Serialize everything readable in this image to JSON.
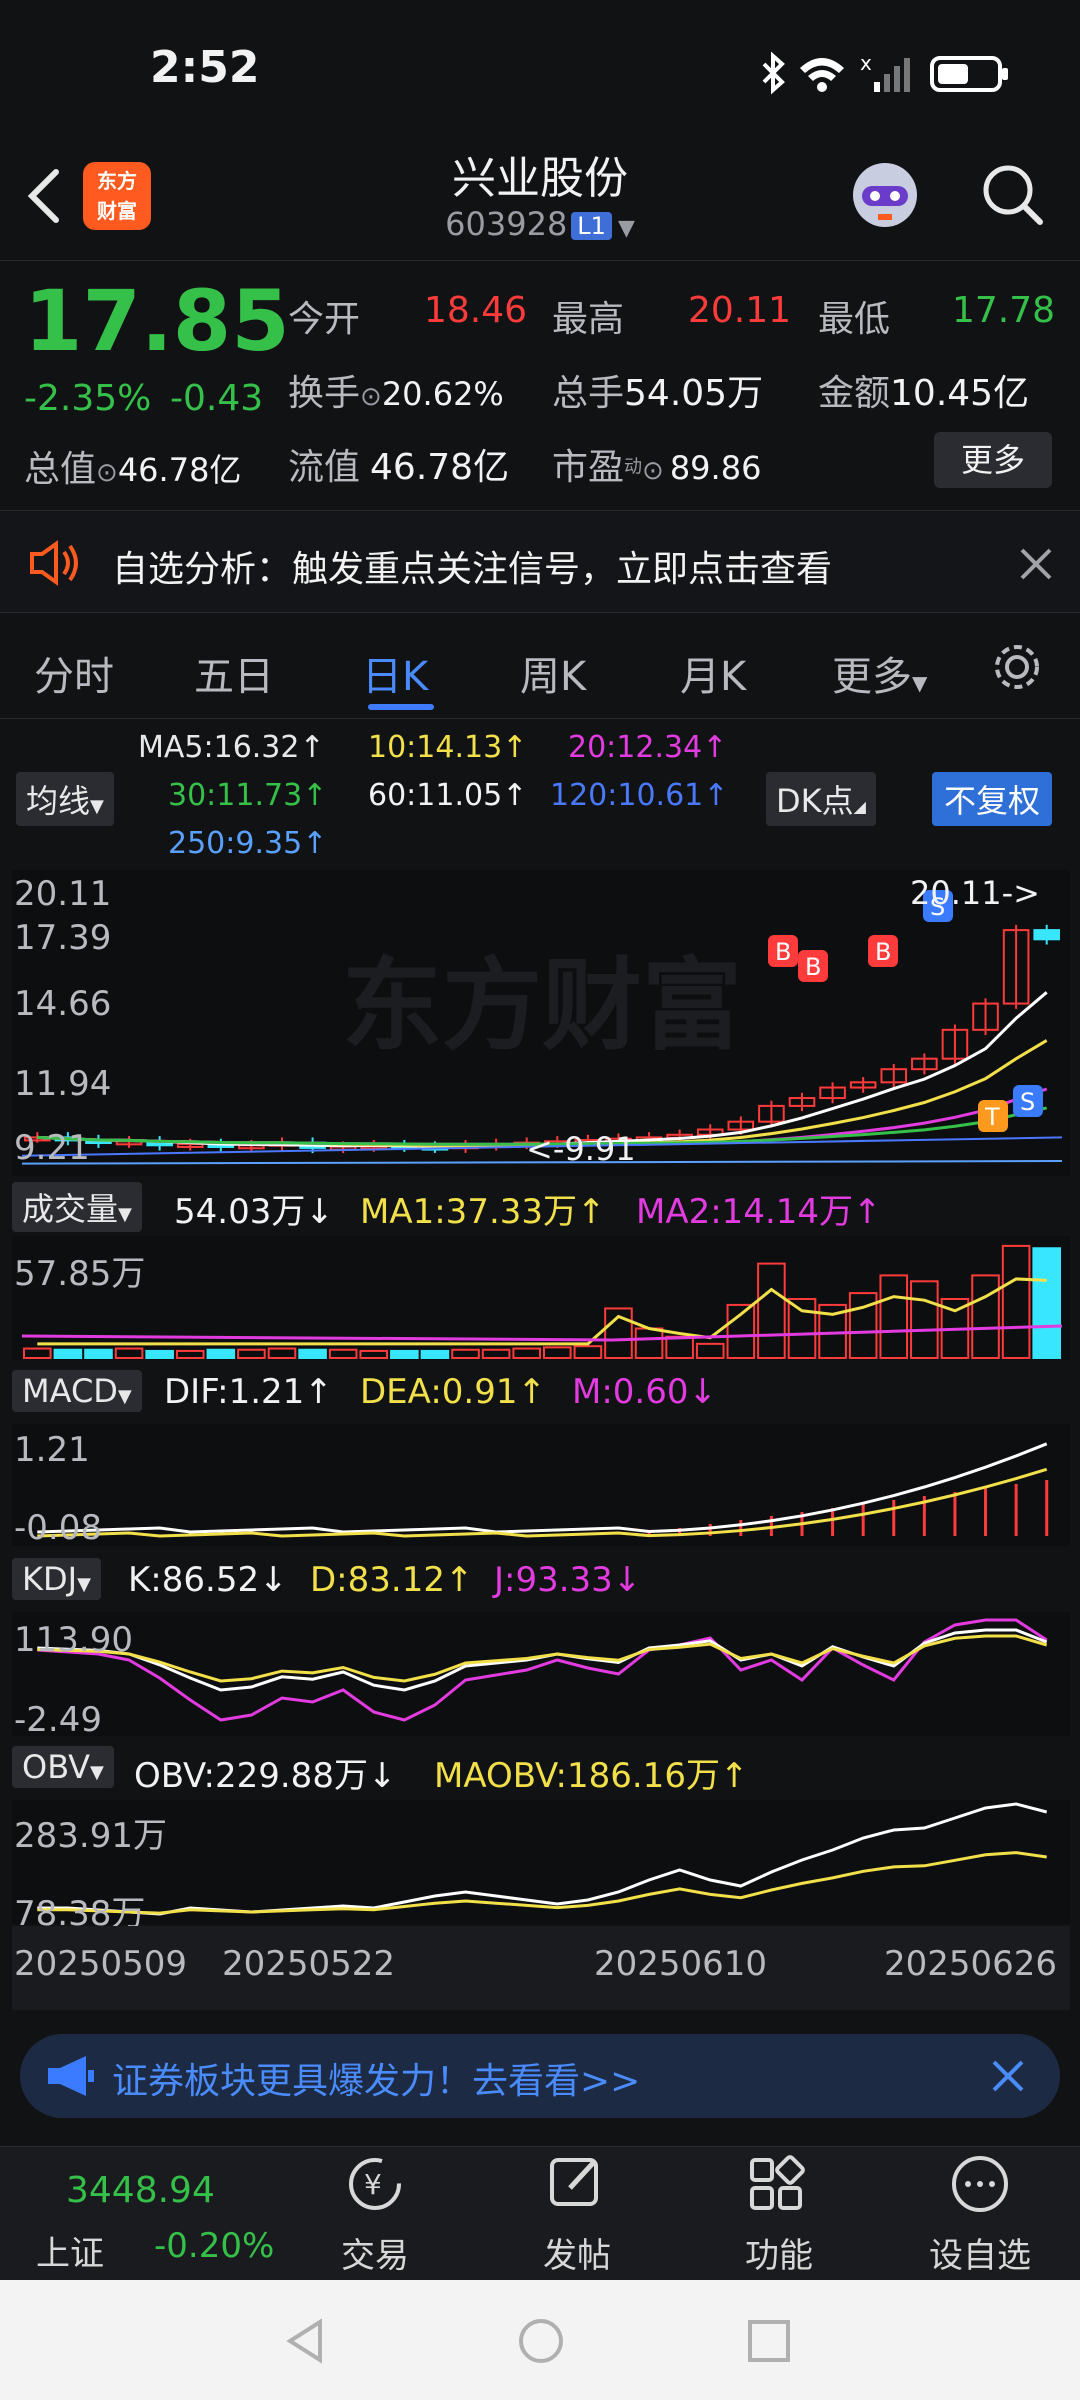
{
  "status_bar": {
    "time": "2:52"
  },
  "header": {
    "logo_text": "东方\n财富",
    "stock_name": "兴业股份",
    "stock_code": "603928",
    "level_badge": "L1"
  },
  "quote": {
    "price": "17.85",
    "change_pct": "-2.35%",
    "change": "-0.43",
    "open_label": "今开",
    "open": "18.46",
    "high_label": "最高",
    "high": "20.11",
    "low_label": "最低",
    "low": "17.78",
    "turnover_label": "换手",
    "turnover": "20.62%",
    "volume_label": "总手",
    "volume": "54.05万",
    "amount_label": "金额",
    "amount": "10.45亿",
    "total_value_label": "总值",
    "total_value": "46.78亿",
    "float_value_label": "流值",
    "float_value": "46.78亿",
    "pe_label": "市盈",
    "pe_sup": "动",
    "pe": "89.86",
    "more_label": "更多"
  },
  "banner": {
    "text": "自选分析：触发重点关注信号，立即点击查看"
  },
  "tabs": [
    {
      "label": "分时"
    },
    {
      "label": "五日"
    },
    {
      "label": "日K"
    },
    {
      "label": "周K"
    },
    {
      "label": "月K"
    },
    {
      "label": "更多"
    }
  ],
  "ma_info": {
    "selector": "均线",
    "ma5": "MA5:16.32↑",
    "ma10": "10:14.13↑",
    "ma20": "20:12.34↑",
    "ma30": "30:11.73↑",
    "ma60": "60:11.05↑",
    "ma120": "120:10.61↑",
    "ma250": "250:9.35↑",
    "dk_button": "DK点",
    "adjust_button": "不复权"
  },
  "colors": {
    "up": "#ff3b3b",
    "down": "#35c04a",
    "accent": "#3f7bff",
    "cyan": "#39e6ff",
    "yellow": "#f2e04a",
    "magenta": "#e23be0"
  },
  "price_chart": {
    "y_labels": [
      "20.11",
      "17.39",
      "14.66",
      "11.94",
      "9.21"
    ],
    "high_marker": "20.11->",
    "low_marker": "<-9.91",
    "watermark": "东方财富",
    "signals": [
      "B",
      "B",
      "B",
      "S",
      "S",
      "S",
      "T"
    ]
  },
  "volume_panel": {
    "selector": "成交量",
    "value": "54.03万↓",
    "ma1": "MA1:37.33万↑",
    "ma2": "MA2:14.14万↑",
    "y_top": "57.85万"
  },
  "macd_panel": {
    "selector": "MACD",
    "dif": "DIF:1.21↑",
    "dea": "DEA:0.91↑",
    "m": "M:0.60↓",
    "y_top": "1.21",
    "y_bottom": "-0.08"
  },
  "kdj_panel": {
    "selector": "KDJ",
    "k": "K:86.52↓",
    "d": "D:83.12↑",
    "j": "J:93.33↓",
    "y_top": "113.90",
    "y_bottom": "-2.49"
  },
  "obv_panel": {
    "selector": "OBV",
    "obv": "OBV:229.88万↓",
    "maobv": "MAOBV:186.16万↑",
    "y_top": "283.91万",
    "y_bottom": "78.38万"
  },
  "x_axis": [
    "20250509",
    "20250522",
    "20250610",
    "20250626"
  ],
  "ad": {
    "text": "证券板块更具爆发力！去看看>>"
  },
  "bottom_nav": {
    "index_value": "3448.94",
    "index_name": "上证",
    "index_change": "-0.20%",
    "items": [
      {
        "label": "交易"
      },
      {
        "label": "发帖"
      },
      {
        "label": "功能"
      },
      {
        "label": "设自选"
      }
    ]
  }
}
